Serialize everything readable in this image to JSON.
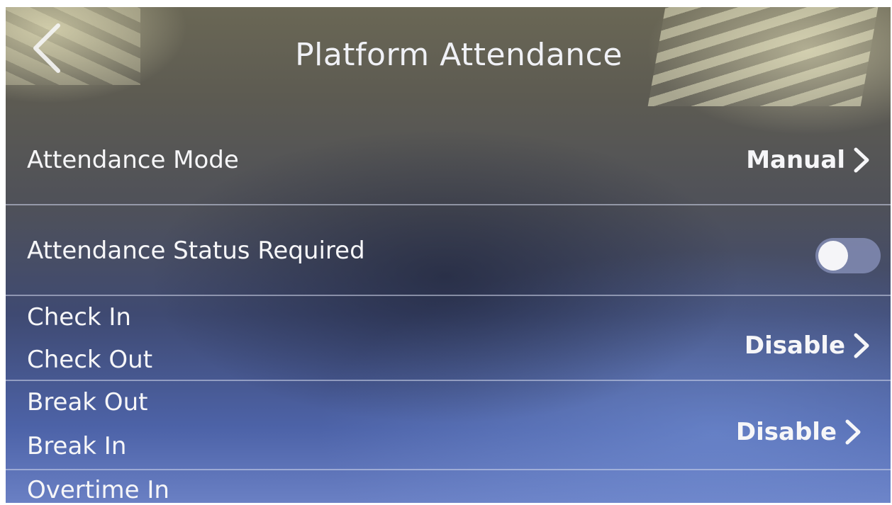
{
  "header": {
    "title": "Platform Attendance",
    "back_icon": "chevron-left-icon"
  },
  "rows": {
    "attendance_mode": {
      "label": "Attendance Mode",
      "value": "Manual"
    },
    "status_required": {
      "label": "Attendance Status Required",
      "toggle_on": false
    },
    "check_pair": {
      "line1": "Check In",
      "line2": "Check Out",
      "value": "Disable"
    },
    "break_pair": {
      "line1": "Break Out",
      "line2": "Break In",
      "value": "Disable"
    },
    "overtime": {
      "line1": "Overtime In"
    }
  },
  "colors": {
    "text": "#f4f4f6",
    "divider": "#d2d7eb",
    "toggle_track": "#828cb4"
  }
}
